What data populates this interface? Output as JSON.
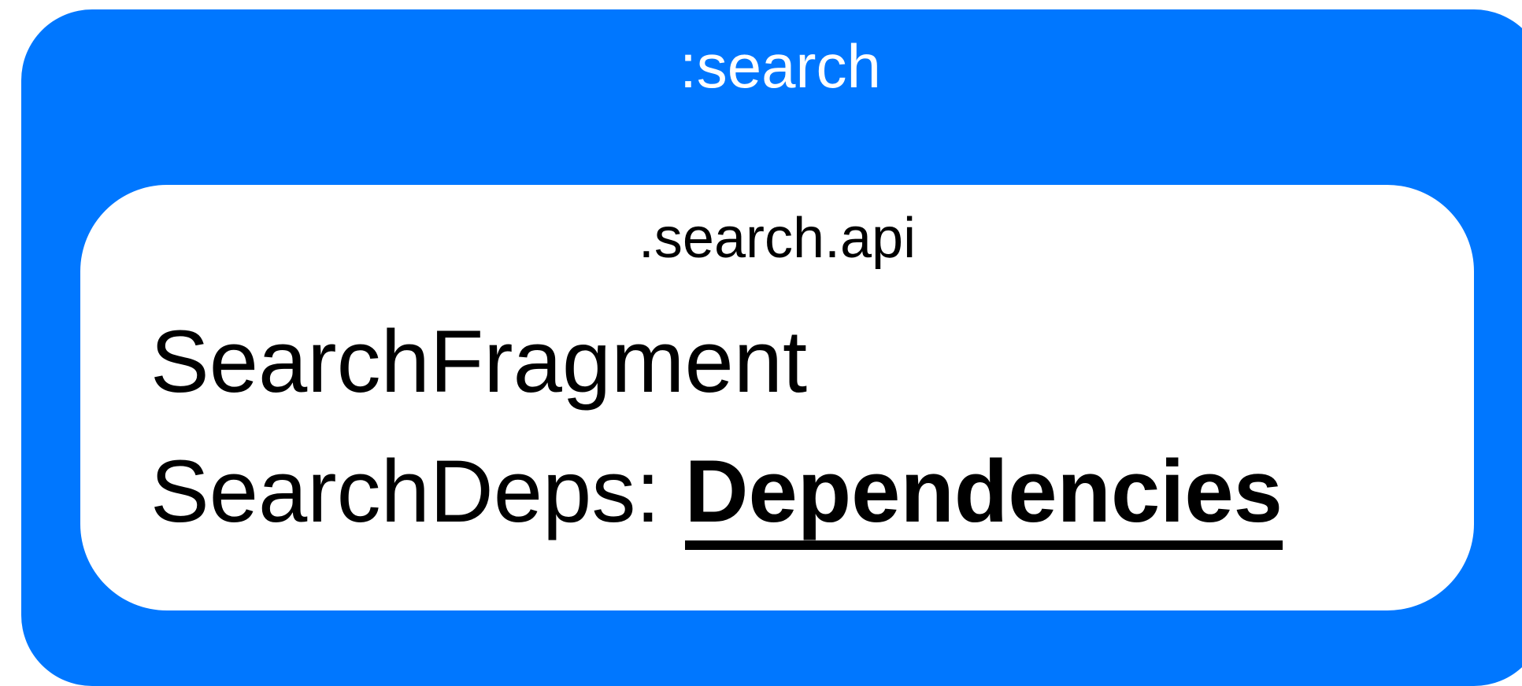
{
  "module": {
    "title": ":search",
    "color": "#0077ff"
  },
  "api": {
    "title": ".search.api",
    "fragment": "SearchFragment",
    "deps_name": "SearchDeps: ",
    "deps_type": "Dependencies"
  }
}
